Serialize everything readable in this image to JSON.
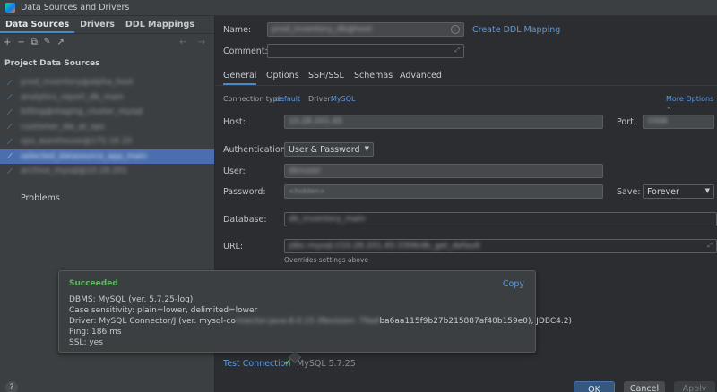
{
  "window": {
    "title": "Data Sources and Drivers"
  },
  "left_panel": {
    "tabs": [
      "Data Sources",
      "Drivers",
      "DDL Mappings"
    ],
    "toolbar": {
      "add": "+",
      "remove": "−",
      "copy": "⧉",
      "wrench": "🔧",
      "export": "↗",
      "back": "←",
      "forward": "→"
    },
    "section_title": "Project Data Sources",
    "items": [
      "prod_inventory@alpha_host",
      "analytics_report_db_main",
      "billing@staging_cluster_mysql",
      "customer_dw_at_ops",
      "ops_warehouse@172.16.10",
      "selected_datasource_app_main",
      "archive_mysql@10.28.201"
    ],
    "selected_index": 5,
    "problems_label": "Problems",
    "help": "?"
  },
  "form": {
    "name_label": "Name:",
    "name_value": "prod_inventory_db@host",
    "create_ddl": "Create DDL Mapping",
    "comment_label": "Comment:",
    "tabs": [
      "General",
      "Options",
      "SSH/SSL",
      "Schemas",
      "Advanced"
    ],
    "connection_type_label": "Connection type:",
    "connection_type_value": "default",
    "driver_label": "Driver:",
    "driver_value": "MySQL",
    "more_options": "More Options ⌄",
    "host_label": "Host:",
    "host_value": "10.28.201.45",
    "port_label": "Port:",
    "port_value": "3306",
    "auth_label": "Authentication:",
    "auth_value": "User & Password",
    "user_label": "User:",
    "user_value": "devuser",
    "password_label": "Password:",
    "password_value": "<hidden>",
    "save_label": "Save:",
    "save_value": "Forever",
    "database_label": "Database:",
    "database_value": "db_inventory_main",
    "url_label": "URL:",
    "url_value": "jdbc:mysql://10.28.201.45:3306/db_get_default",
    "url_note": "Overrides settings above"
  },
  "popup": {
    "status": "Succeeded",
    "copy": "Copy",
    "dbms": "DBMS: MySQL (ver. 5.7.25-log)",
    "case": "Case sensitivity: plain=lower, delimited=lower",
    "driver_prefix": "Driver: MySQL Connector/J (ver. mysql-co",
    "driver_hidden": "nnector-java-8.0.15 (Revision: 79a4",
    "driver_suffix": "ba6aa115f9b27b215887af40b159e0), JDBC4.2)",
    "ping": "Ping: 186 ms",
    "ssl": "SSL: yes"
  },
  "footer": {
    "test_connection": "Test Connection",
    "test_result": "MySQL 5.7.25",
    "ok": "OK",
    "cancel": "Cancel",
    "apply": "Apply"
  },
  "colors": {
    "accent": "#4a88c7",
    "link": "#5c9ae0",
    "success": "#5fb85f",
    "selection": "#4b6eaf"
  }
}
